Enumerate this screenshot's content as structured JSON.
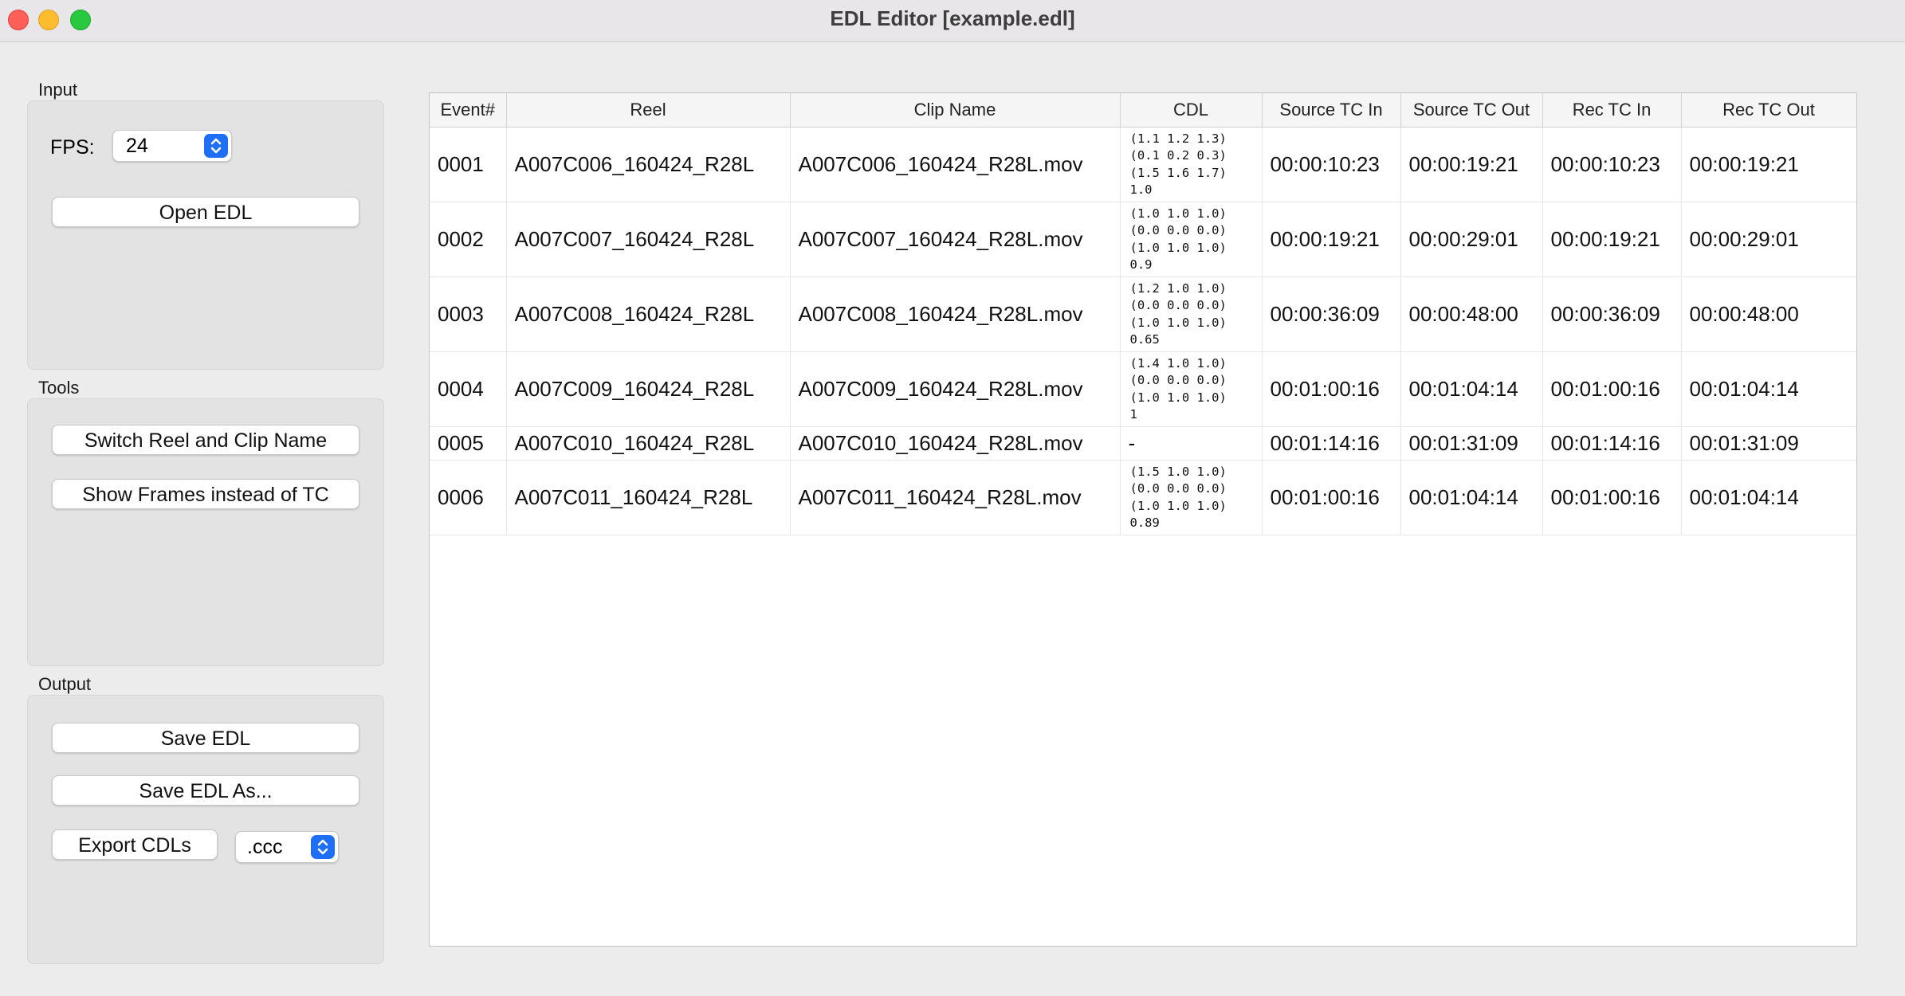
{
  "window": {
    "title": "EDL Editor [example.edl]"
  },
  "input": {
    "group_label": "Input",
    "fps_label": "FPS:",
    "fps_value": "24",
    "open_button": "Open EDL"
  },
  "tools": {
    "group_label": "Tools",
    "switch_button": "Switch Reel and Clip Name",
    "frames_button": "Show Frames instead of TC"
  },
  "output": {
    "group_label": "Output",
    "save_button": "Save EDL",
    "save_as_button": "Save EDL As...",
    "export_button": "Export CDLs",
    "format_value": ".ccc"
  },
  "table": {
    "columns": [
      "Event#",
      "Reel",
      "Clip Name",
      "CDL",
      "Source TC In",
      "Source TC Out",
      "Rec TC In",
      "Rec TC Out"
    ],
    "rows": [
      {
        "event": "0001",
        "reel": "A007C006_160424_R28L",
        "clip": "A007C006_160424_R28L.mov",
        "cdl": "(1.1 1.2 1.3)\n(0.1 0.2 0.3)\n(1.5 1.6 1.7)\n1.0",
        "src_in": "00:00:10:23",
        "src_out": "00:00:19:21",
        "rec_in": "00:00:10:23",
        "rec_out": "00:00:19:21"
      },
      {
        "event": "0002",
        "reel": "A007C007_160424_R28L",
        "clip": "A007C007_160424_R28L.mov",
        "cdl": "(1.0 1.0 1.0)\n(0.0 0.0 0.0)\n(1.0 1.0 1.0)\n0.9",
        "src_in": "00:00:19:21",
        "src_out": "00:00:29:01",
        "rec_in": "00:00:19:21",
        "rec_out": "00:00:29:01"
      },
      {
        "event": "0003",
        "reel": "A007C008_160424_R28L",
        "clip": "A007C008_160424_R28L.mov",
        "cdl": "(1.2 1.0 1.0)\n(0.0 0.0 0.0)\n(1.0 1.0 1.0)\n0.65",
        "src_in": "00:00:36:09",
        "src_out": "00:00:48:00",
        "rec_in": "00:00:36:09",
        "rec_out": "00:00:48:00"
      },
      {
        "event": "0004",
        "reel": "A007C009_160424_R28L",
        "clip": "A007C009_160424_R28L.mov",
        "cdl": "(1.4 1.0 1.0)\n(0.0 0.0 0.0)\n(1.0 1.0 1.0)\n1",
        "src_in": "00:01:00:16",
        "src_out": "00:01:04:14",
        "rec_in": "00:01:00:16",
        "rec_out": "00:01:04:14"
      },
      {
        "event": "0005",
        "reel": "A007C010_160424_R28L",
        "clip": "A007C010_160424_R28L.mov",
        "cdl": "-",
        "src_in": "00:01:14:16",
        "src_out": "00:01:31:09",
        "rec_in": "00:01:14:16",
        "rec_out": "00:01:31:09"
      },
      {
        "event": "0006",
        "reel": "A007C011_160424_R28L",
        "clip": "A007C011_160424_R28L.mov",
        "cdl": "(1.5 1.0 1.0)\n(0.0 0.0 0.0)\n(1.0 1.0 1.0)\n0.89",
        "src_in": "00:01:00:16",
        "src_out": "00:01:04:14",
        "rec_in": "00:01:00:16",
        "rec_out": "00:01:04:14"
      }
    ]
  }
}
